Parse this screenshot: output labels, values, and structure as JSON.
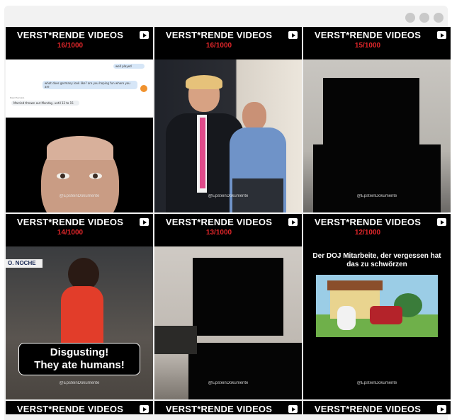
{
  "window": {
    "control_dots": [
      "dot",
      "dot",
      "dot"
    ]
  },
  "tiles": [
    {
      "title": "VERST*RENDE VIDEOS",
      "count": "16/1000",
      "watermark": "@EpsteinDokumente"
    },
    {
      "title": "VERST*RENDE VIDEOS",
      "count": "16/1000",
      "watermark": "@EpsteinDokumente"
    },
    {
      "title": "VERST*RENDE VIDEOS",
      "count": "15/1000",
      "watermark": "@EpsteinDokumente"
    },
    {
      "title": "VERST*RENDE VIDEOS",
      "count": "14/1000",
      "watermark": "@EpsteinDokumente",
      "news_tag": "O. NOCHE",
      "caption_line1": "Disgusting!",
      "caption_line2": "They ate humans!"
    },
    {
      "title": "VERST*RENDE VIDEOS",
      "count": "13/1000",
      "watermark": "@EpsteinDokumente"
    },
    {
      "title": "VERST*RENDE VIDEOS",
      "count": "12/1000",
      "watermark": "@EpsteinDokumente",
      "overlay_text": "Der DOJ Mitarbeite, der vergessen hat das zu schwörzen"
    },
    {
      "title": "VERST*RENDE VIDEOS"
    },
    {
      "title": "VERST*RENDE VIDEOS"
    },
    {
      "title": "VERST*RENDE VIDEOS"
    }
  ],
  "chat": {
    "msg1": "well played",
    "msg2": "what does germany look like? are you hoping fun where you are",
    "sep": "Dead Servers",
    "msg3": "Married thrown out Monday, until 12 to 15"
  },
  "colors": {
    "accent_red": "#e0262a",
    "tile_bg": "#000000"
  }
}
